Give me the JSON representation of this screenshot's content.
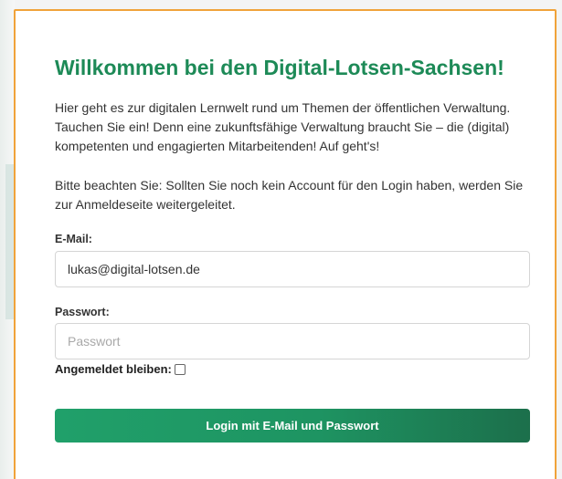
{
  "page": {
    "title": "Willkommen bei den Digital-Lotsen-Sachsen!",
    "intro": "Hier geht es zur digitalen Lernwelt rund um Themen der öffentlichen Verwaltung. Tauchen Sie ein! Denn eine zukunftsfähige Verwaltung braucht Sie – die (digital) kompetenten und engagierten Mitarbeitenden! Auf geht's!",
    "notice": "Bitte beachten Sie: Sollten Sie noch kein Account für den Login haben, werden Sie zur Anmeldeseite weitergeleitet."
  },
  "form": {
    "email_label": "E-Mail:",
    "email_value": "lukas@digital-lotsen.de",
    "password_label": "Passwort:",
    "password_placeholder": "Passwort",
    "remember_label": "Angemeldet bleiben:",
    "remember_checked": false,
    "login_button": "Login mit E-Mail und Passwort"
  },
  "colors": {
    "title_green": "#1d8a57",
    "button_green": "#1e9462",
    "card_border_orange": "#f0a33a"
  }
}
